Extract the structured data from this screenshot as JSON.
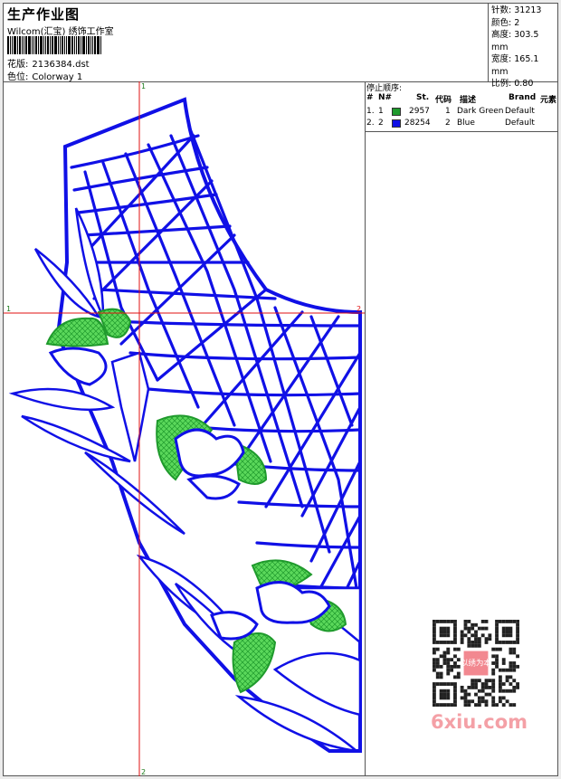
{
  "header": {
    "title": "生产作业图",
    "studio": "Wilcom(汇宝) 绣饰工作室",
    "design_label": "花版:",
    "design_file": "2136384.dst",
    "colorway_label": "色位:",
    "colorway": "Colorway 1"
  },
  "stats": {
    "stitches_label": "针数:",
    "stitches": "31213",
    "colors_label": "颜色:",
    "colors": "2",
    "height_label": "高度:",
    "height": "303.5 mm",
    "width_label": "宽度:",
    "width": "165.1 mm",
    "scale_label": "比例:",
    "scale": "0.80"
  },
  "stop_sequence": {
    "title": "停止顺序:",
    "columns": [
      "#",
      "N#",
      "St.",
      "代码",
      "描述",
      "Brand",
      "元素"
    ],
    "rows": [
      {
        "num": "1.",
        "n": "1",
        "color": "#1f9a2c",
        "st": "2957",
        "code": "1",
        "desc": "Dark Green",
        "brand": "Default"
      },
      {
        "num": "2.",
        "n": "2",
        "color": "#1010e6",
        "st": "28254",
        "code": "2",
        "desc": "Blue",
        "brand": "Default"
      }
    ]
  },
  "axes": {
    "v_top": "1",
    "v_bottom": "2",
    "h_left": "1",
    "h_right": "2"
  },
  "watermark": {
    "site": "6xiu.com",
    "seal": "以绣为本"
  },
  "colors": {
    "thread_green": "#1f9a2c",
    "thread_blue": "#1010e6",
    "fill_green": "#5bd85b",
    "axis_red": "#e01010"
  }
}
